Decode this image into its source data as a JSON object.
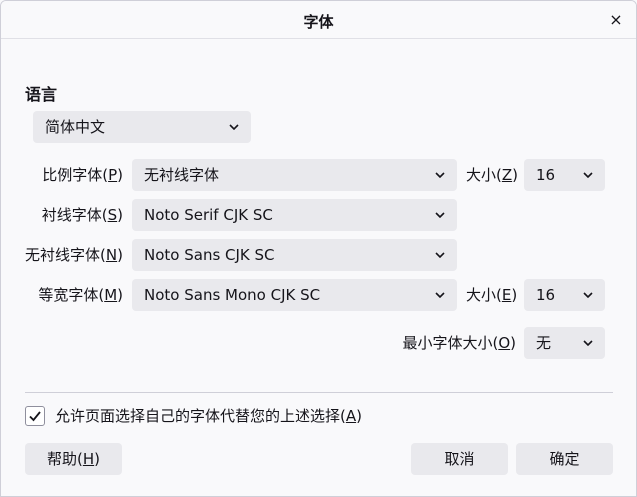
{
  "window": {
    "title": "字体",
    "close_label": "×"
  },
  "language": {
    "heading": "语言",
    "selected": "简体中文"
  },
  "fonts": {
    "proportional_label": "比例字体(",
    "proportional_key": "P",
    "proportional_value": "无衬线字体",
    "proportional_size_label": "大小(",
    "proportional_size_key": "Z",
    "proportional_size_value": "16",
    "serif_label": "衬线字体(",
    "serif_key": "S",
    "serif_value": "Noto Serif CJK SC",
    "sans_label": "无衬线字体(",
    "sans_key": "N",
    "sans_value": "Noto Sans CJK SC",
    "mono_label": "等宽字体(",
    "mono_key": "M",
    "mono_value": "Noto Sans Mono CJK SC",
    "mono_size_label": "大小(",
    "mono_size_key": "E",
    "mono_size_value": "16",
    "min_size_label": "最小字体大小(",
    "min_size_key": "O",
    "min_size_value": "无",
    "close_paren": ")"
  },
  "allow_pages": {
    "checked": true,
    "label": "允许页面选择自己的字体代替您的上述选择(",
    "key": "A"
  },
  "buttons": {
    "help_label": "帮助(",
    "help_key": "H",
    "cancel": "取消",
    "ok": "确定"
  }
}
